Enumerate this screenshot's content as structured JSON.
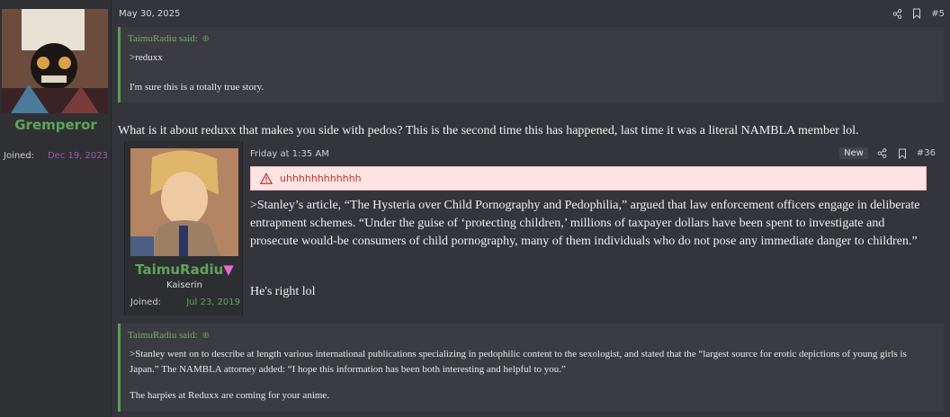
{
  "main_author": {
    "username": "Gremperor",
    "joined_label": "Joined:",
    "joined_value": "Dec 19, 2023"
  },
  "post": {
    "date": "May 30, 2025",
    "post_number": "#5",
    "quote1": {
      "author": "TaimuRadiu said:",
      "lines": [
        ">reduxx",
        "I'm sure this is a totally true story."
      ]
    },
    "main_text": "What is it about reduxx that makes you side with pedos? This is the second time this has happened, last time it was a literal NAMBLA member lol.",
    "quote2": {
      "author": "TaimuRadiu said:",
      "lines": [
        ">Stanley went on to describe at length various international publications specializing in pedophilic content to the sexologist, and stated that the “largest source for erotic depictions of young girls is Japan.” The NAMBLA attorney added: “I hope this information has been both interesting and helpful to you.”",
        "The harpies at Reduxx are coming for your anime."
      ]
    }
  },
  "embedded_post": {
    "username": "TaimuRadiu",
    "user_title": "Kaiserin",
    "joined_label": "Joined:",
    "joined_value": "Jul 23, 2019",
    "date": "Friday at 1:35 AM",
    "badge": "New",
    "post_number": "#36",
    "warning_text": "uhhhhhhhhhhhh",
    "text": ">Stanley’s article, “The Hysteria over Child Pornography and Pedophilia,” argued that law enforcement officers engage in deliberate entrapment schemes. “Under the guise of ‘protecting children,’ millions of taxpayer dollars have been spent to investigate and prosecute would-be consumers of child pornography, many of them individuals who do not pose any immediate danger to children.”",
    "tail": "He's right lol"
  }
}
